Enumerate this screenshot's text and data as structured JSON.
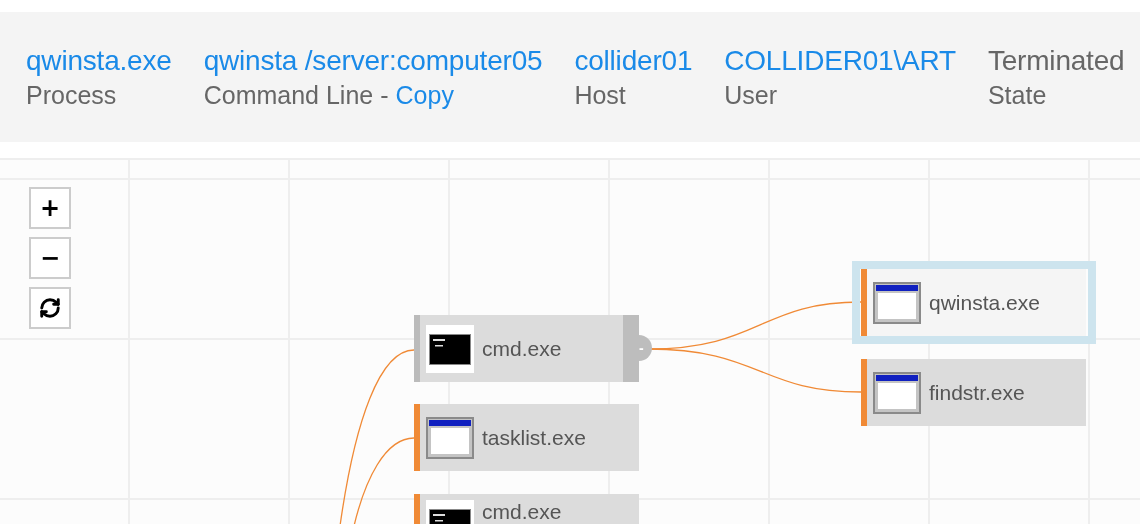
{
  "details": [
    {
      "value": "qwinsta.exe",
      "label": "Process"
    },
    {
      "value": "qwinsta /server:computer05",
      "label": "Command Line",
      "separator": "-",
      "link": "Copy"
    },
    {
      "value": "collider01",
      "label": "Host"
    },
    {
      "value": "COLLIDER01\\ART",
      "label": "User"
    },
    {
      "value": "Terminated",
      "label": "State",
      "kind": "plain"
    }
  ],
  "zoom_controls": [
    "+",
    "−"
  ],
  "nodes": [
    {
      "label": "cmd.exe",
      "kind": "console",
      "color": "#bbbbbb",
      "expanded": true,
      "handle_symbol": "-",
      "selected": false
    },
    {
      "label": "tasklist.exe",
      "kind": "window",
      "color": "#f08a36",
      "selected": false
    },
    {
      "label": "cmd.exe",
      "kind": "console",
      "color": "#f08a36",
      "selected": false
    },
    {
      "label": "qwinsta.exe",
      "kind": "window",
      "color": "#f08a36",
      "selected": true
    },
    {
      "label": "findstr.exe",
      "kind": "window",
      "color": "#f08a36",
      "selected": false
    }
  ]
}
